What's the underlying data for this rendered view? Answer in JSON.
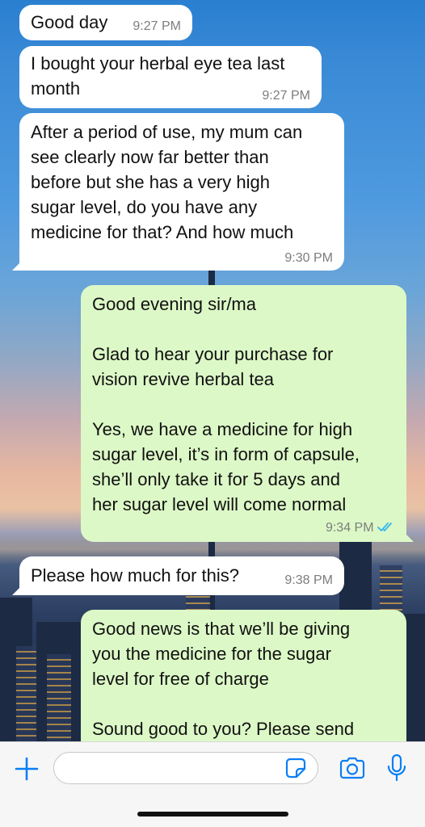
{
  "messages": [
    {
      "dir": "in",
      "text": "Good day",
      "time": "9:27 PM"
    },
    {
      "dir": "in",
      "text": "I bought your herbal eye tea last\nmonth",
      "time": "9:27 PM"
    },
    {
      "dir": "in",
      "text": "After a period of use, my mum can\nsee clearly now far better than\nbefore but she has a very high\nsugar level, do you have any\nmedicine for that? And how much",
      "time": "9:30 PM"
    },
    {
      "dir": "out",
      "text": "Good evening sir/ma\n\nGlad to hear your purchase for\nvision revive herbal tea\n\nYes, we have a medicine for high\nsugar level, it’s in form of capsule,\nshe’ll only take it for 5 days and\nher sugar level will come normal",
      "time": "9:34 PM",
      "status": "read"
    },
    {
      "dir": "in",
      "text": "Please how much for this?",
      "time": "9:38 PM"
    },
    {
      "dir": "out",
      "text": "Good news is that we’ll be giving\nyou the medicine for the sugar\nlevel for free of charge\n\nSound good to you? Please send",
      "time": ""
    }
  ],
  "composer": {
    "placeholder": "",
    "icons": [
      "plus-icon",
      "sticker-icon",
      "camera-icon",
      "microphone-icon"
    ]
  },
  "colors": {
    "incoming_bubble": "#ffffff",
    "outgoing_bubble": "#dcf8c6",
    "accent": "#0a7ff5",
    "read_ticks": "#34b7f1"
  }
}
